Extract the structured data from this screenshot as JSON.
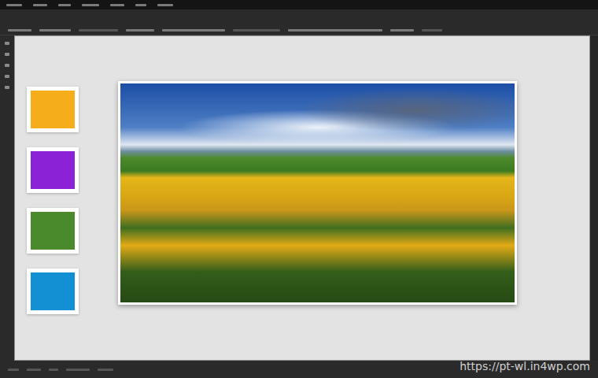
{
  "canvas": {
    "swatches": [
      {
        "color": "#f5ad1b"
      },
      {
        "color": "#8b22d6"
      },
      {
        "color": "#4a8a2c"
      },
      {
        "color": "#1390d4"
      }
    ]
  },
  "watermark": "https://pt-wl.in4wp.com"
}
